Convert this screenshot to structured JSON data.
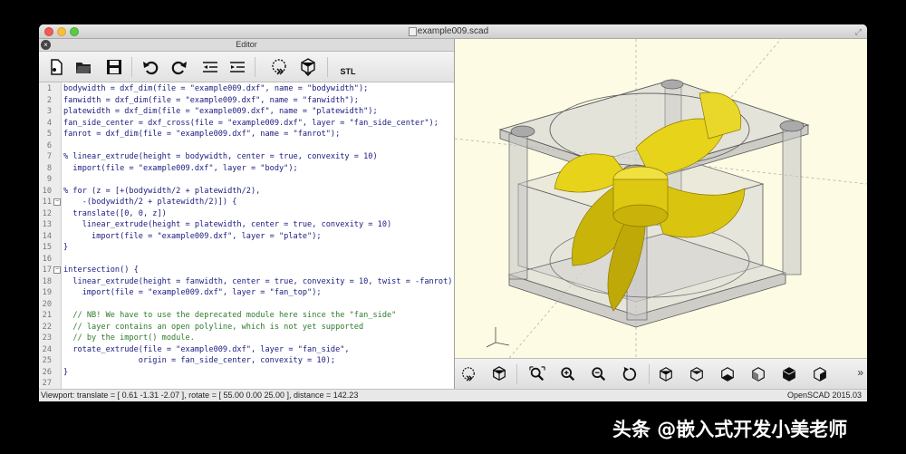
{
  "window": {
    "title": "example009.scad"
  },
  "editor": {
    "title": "Editor",
    "lines": [
      {
        "n": "1",
        "t": "bodywidth = dxf_dim(file = \"example009.dxf\", name = \"bodywidth\");",
        "c": false,
        "fold": false
      },
      {
        "n": "2",
        "t": "fanwidth = dxf_dim(file = \"example009.dxf\", name = \"fanwidth\");",
        "c": false,
        "fold": false
      },
      {
        "n": "3",
        "t": "platewidth = dxf_dim(file = \"example009.dxf\", name = \"platewidth\");",
        "c": false,
        "fold": false
      },
      {
        "n": "4",
        "t": "fan_side_center = dxf_cross(file = \"example009.dxf\", layer = \"fan_side_center\");",
        "c": false,
        "fold": false
      },
      {
        "n": "5",
        "t": "fanrot = dxf_dim(file = \"example009.dxf\", name = \"fanrot\");",
        "c": false,
        "fold": false
      },
      {
        "n": "6",
        "t": "",
        "c": false,
        "fold": false
      },
      {
        "n": "7",
        "t": "% linear_extrude(height = bodywidth, center = true, convexity = 10)",
        "c": false,
        "fold": false
      },
      {
        "n": "8",
        "t": "  import(file = \"example009.dxf\", layer = \"body\");",
        "c": false,
        "fold": false
      },
      {
        "n": "9",
        "t": "",
        "c": false,
        "fold": false
      },
      {
        "n": "10",
        "t": "% for (z = [+(bodywidth/2 + platewidth/2),",
        "c": false,
        "fold": false
      },
      {
        "n": "11",
        "t": "    -(bodywidth/2 + platewidth/2)]) {",
        "c": false,
        "fold": true
      },
      {
        "n": "12",
        "t": "  translate([0, 0, z])",
        "c": false,
        "fold": false
      },
      {
        "n": "13",
        "t": "    linear_extrude(height = platewidth, center = true, convexity = 10)",
        "c": false,
        "fold": false
      },
      {
        "n": "14",
        "t": "      import(file = \"example009.dxf\", layer = \"plate\");",
        "c": false,
        "fold": false
      },
      {
        "n": "15",
        "t": "}",
        "c": false,
        "fold": false
      },
      {
        "n": "16",
        "t": "",
        "c": false,
        "fold": false
      },
      {
        "n": "17",
        "t": "intersection() {",
        "c": false,
        "fold": true
      },
      {
        "n": "18",
        "t": "  linear_extrude(height = fanwidth, center = true, convexity = 10, twist = -fanrot)",
        "c": false,
        "fold": false
      },
      {
        "n": "19",
        "t": "    import(file = \"example009.dxf\", layer = \"fan_top\");",
        "c": false,
        "fold": false
      },
      {
        "n": "20",
        "t": "",
        "c": false,
        "fold": false
      },
      {
        "n": "21",
        "t": "  // NB! We have to use the deprecated module here since the \"fan_side\"",
        "c": true,
        "fold": false
      },
      {
        "n": "22",
        "t": "  // layer contains an open polyline, which is not yet supported",
        "c": true,
        "fold": false
      },
      {
        "n": "23",
        "t": "  // by the import() module.",
        "c": true,
        "fold": false
      },
      {
        "n": "24",
        "t": "  rotate_extrude(file = \"example009.dxf\", layer = \"fan_side\",",
        "c": false,
        "fold": false
      },
      {
        "n": "25",
        "t": "                origin = fan_side_center, convexity = 10);",
        "c": false,
        "fold": false
      },
      {
        "n": "26",
        "t": "}",
        "c": false,
        "fold": false
      },
      {
        "n": "27",
        "t": "",
        "c": false,
        "fold": false
      }
    ]
  },
  "toolbar": {
    "items": [
      {
        "name": "new-file-button",
        "icon": "new-file-icon"
      },
      {
        "name": "open-file-button",
        "icon": "folder-icon"
      },
      {
        "name": "save-button",
        "icon": "floppy-icon"
      },
      {
        "name": "undo-button",
        "icon": "undo-icon"
      },
      {
        "name": "redo-button",
        "icon": "redo-icon"
      },
      {
        "name": "unindent-button",
        "icon": "unindent-icon"
      },
      {
        "name": "indent-button",
        "icon": "indent-icon"
      },
      {
        "name": "preview-button",
        "icon": "preview-icon"
      },
      {
        "name": "render-button",
        "icon": "render-icon"
      },
      {
        "name": "export-stl-button",
        "icon": "stl-icon"
      }
    ],
    "stl_label": "STL"
  },
  "viewer_toolbar": {
    "items": [
      "preview-icon",
      "render-icon",
      "zoom-all-icon",
      "zoom-in-icon",
      "zoom-out-icon",
      "reset-view-icon",
      "view-right-icon",
      "view-top-icon",
      "view-bottom-icon",
      "view-left-icon",
      "view-front-icon",
      "view-back-icon"
    ],
    "more": "»"
  },
  "status": {
    "viewport": "Viewport: translate = [ 0.61 -1.31 -2.07 ], rotate = [ 55.00 0.00 25.00 ], distance = 142.23",
    "version": "OpenSCAD 2015.03"
  },
  "watermark": "头条 @嵌入式开发小美老师",
  "colors": {
    "viewport_bg": "#fdfbe4",
    "fan": "#e6d31a",
    "body": "#c8c8c8"
  }
}
